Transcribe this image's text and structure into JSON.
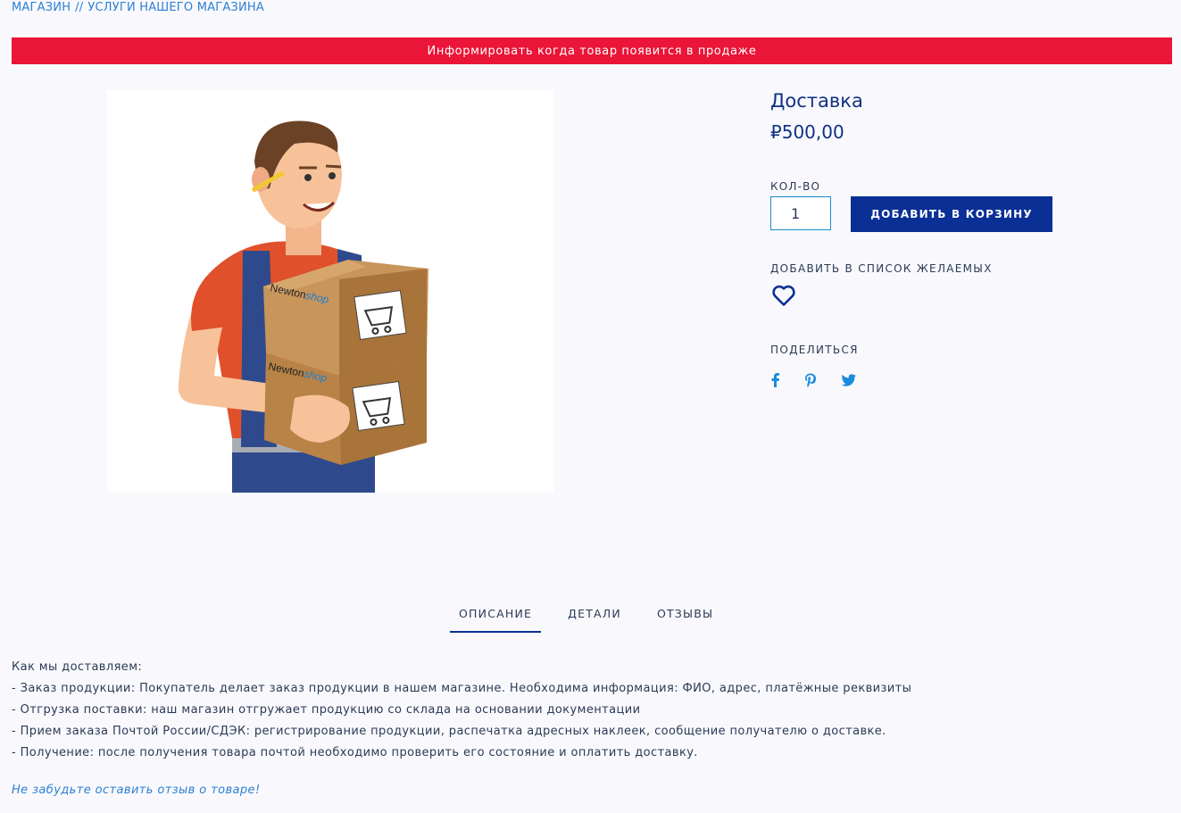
{
  "breadcrumb": [
    "МАГАЗИН",
    "УСЛУГИ НАШЕГО МАГАЗИНА"
  ],
  "notify_bar": "Информировать когда товар появится в продаже",
  "product": {
    "title": "Доставка",
    "price": "₽500,00",
    "image_box_labels": [
      "Newton",
      "shop"
    ],
    "qty_label": "КОЛ-ВО",
    "qty_value": "1",
    "add_to_cart": "ДОБАВИТЬ В КОРЗИНУ",
    "wishlist_label": "ДОБАВИТЬ В СПИСОК ЖЕЛАЕМЫХ",
    "share_label": "ПОДЕЛИТЬСЯ",
    "share_icons": [
      "facebook-icon",
      "pinterest-icon",
      "twitter-icon"
    ]
  },
  "tabs": [
    {
      "label": "ОПИСАНИЕ",
      "active": true
    },
    {
      "label": "ДЕТАЛИ",
      "active": false
    },
    {
      "label": "ОТЗЫВЫ",
      "active": false
    }
  ],
  "description": [
    "Как мы доставляем:",
    "- Заказ продукции: Покупатель делает заказ продукции в нашем магазине. Необходима информация: ФИО, адрес, платёжные реквизиты",
    "- Отгрузка поставки: наш магазин отгружает продукцию со склада на основании документации",
    "- Прием заказа Почтой России/СДЭК: регистрирование продукции, распечатка адресных наклеек, сообщение получателю о доставке.",
    "- Получение: после получения товара почтой необходимо проверить его состояние и оплатить доставку."
  ],
  "review_hint": "Не забудьте оставить отзыв о товаре!",
  "colors": {
    "accent": "#0a2f95",
    "alert": "#ea1538",
    "link": "#2d7fd2"
  }
}
